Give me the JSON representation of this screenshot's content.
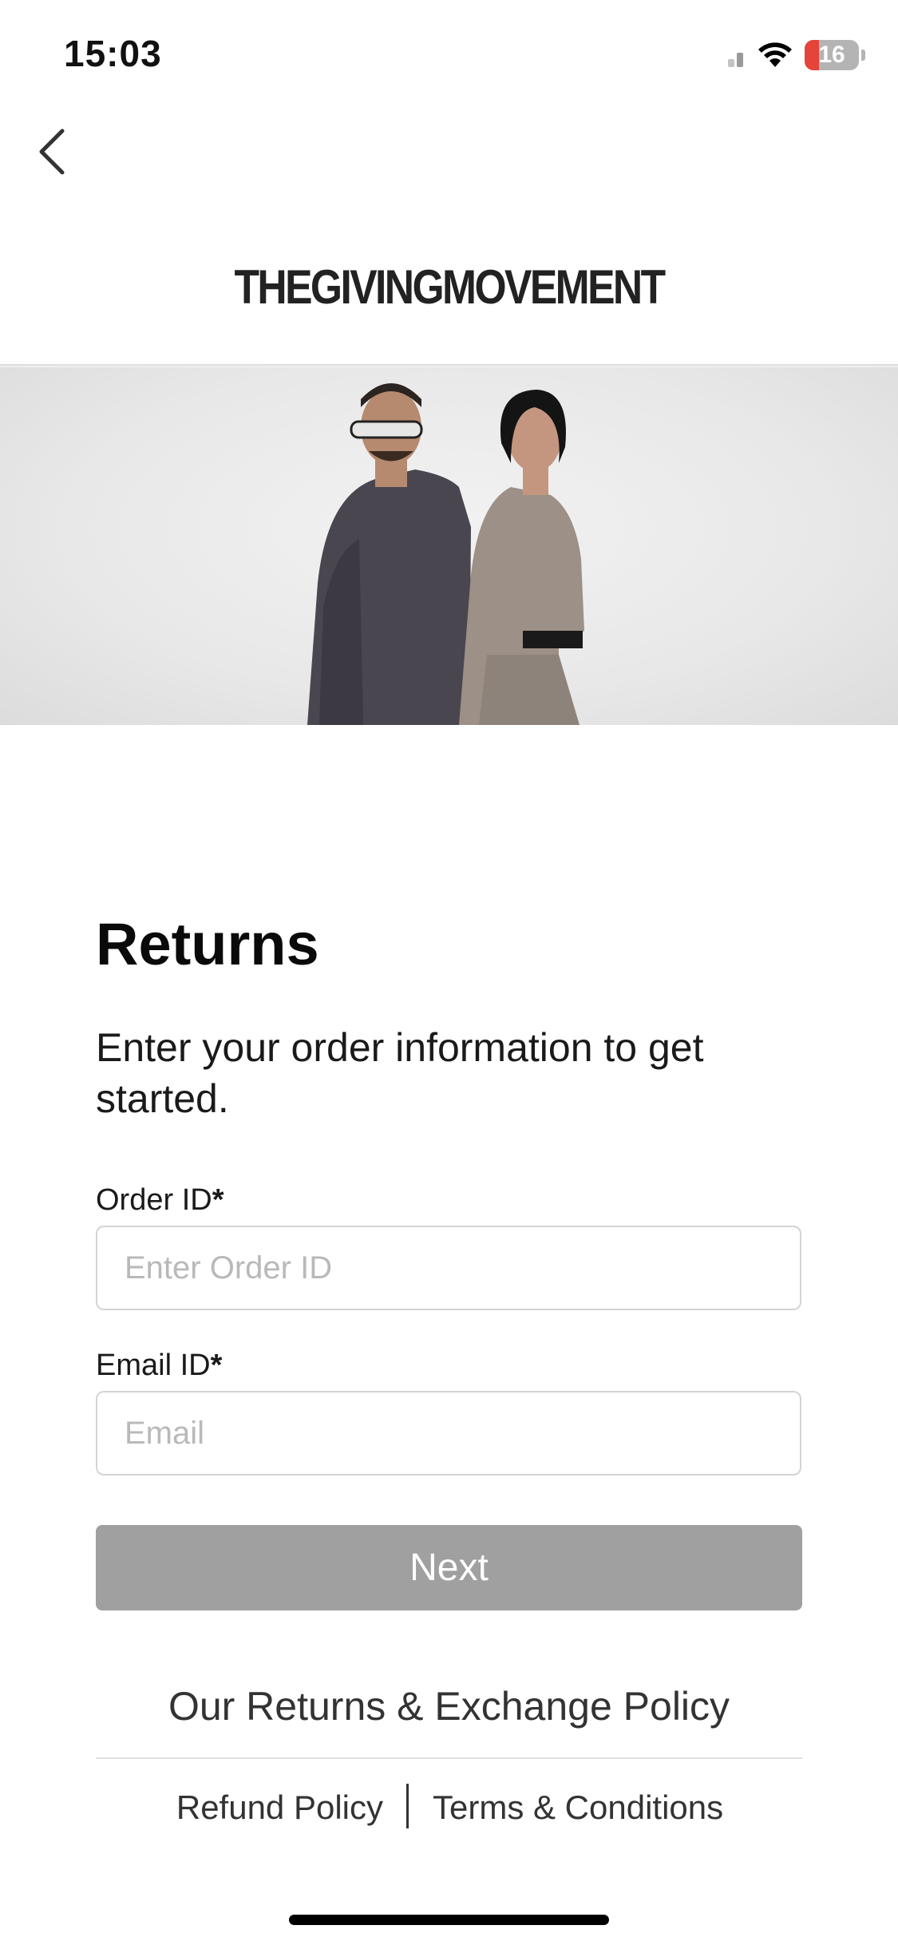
{
  "status_bar": {
    "time": "15:03",
    "battery_percent": "16",
    "icons": [
      "cellular-signal-icon",
      "wifi-icon",
      "battery-icon"
    ]
  },
  "nav": {
    "back_icon": "chevron-left-icon"
  },
  "brand": {
    "name": "THEGIVINGMOVEMENT"
  },
  "hero": {
    "image_alt": ""
  },
  "returns": {
    "title": "Returns",
    "subtitle": "Enter your order information to get started."
  },
  "form": {
    "order_id": {
      "label": "Order ID",
      "required_mark": "*",
      "placeholder": "Enter Order ID",
      "value": ""
    },
    "email": {
      "label": "Email ID",
      "required_mark": "*",
      "placeholder": "Email",
      "value": ""
    },
    "next_label": "Next"
  },
  "footer": {
    "policy_link": "Our Returns & Exchange Policy",
    "refund_policy": "Refund Policy",
    "terms": "Terms & Conditions"
  },
  "colors": {
    "button_disabled": "#a0a0a0",
    "input_border": "#d4d4d4",
    "battery_low": "#e5443a"
  }
}
